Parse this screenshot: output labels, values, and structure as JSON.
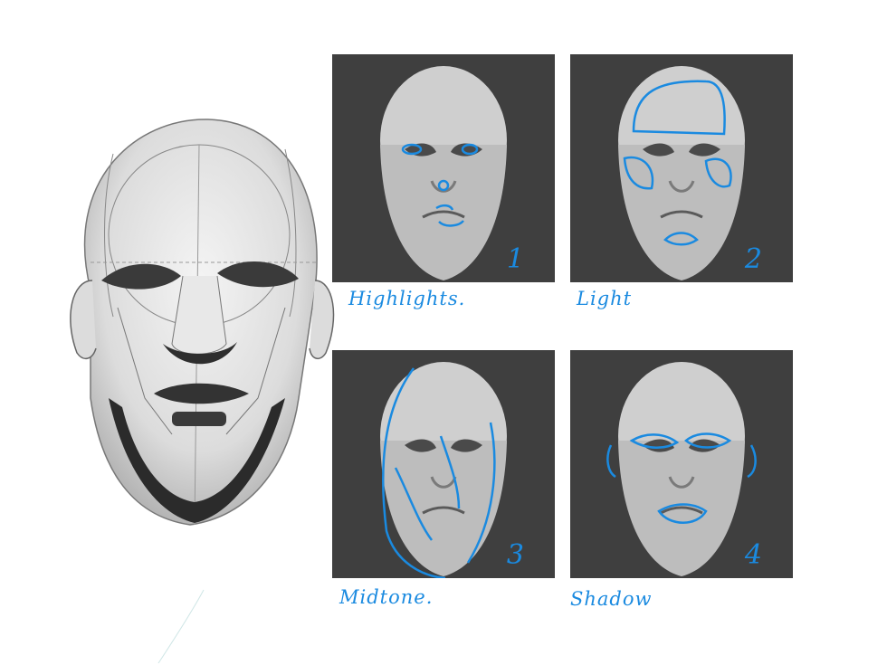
{
  "panels": [
    {
      "number": "1",
      "caption": "Highlights."
    },
    {
      "number": "2",
      "caption": "Light"
    },
    {
      "number": "3",
      "caption": "Midtone."
    },
    {
      "number": "4",
      "caption": "Shadow"
    }
  ],
  "colors": {
    "panel_bg": "#3f3f3f",
    "annotation_blue": "#1a8ae0",
    "sketch_gray": "#555555"
  }
}
